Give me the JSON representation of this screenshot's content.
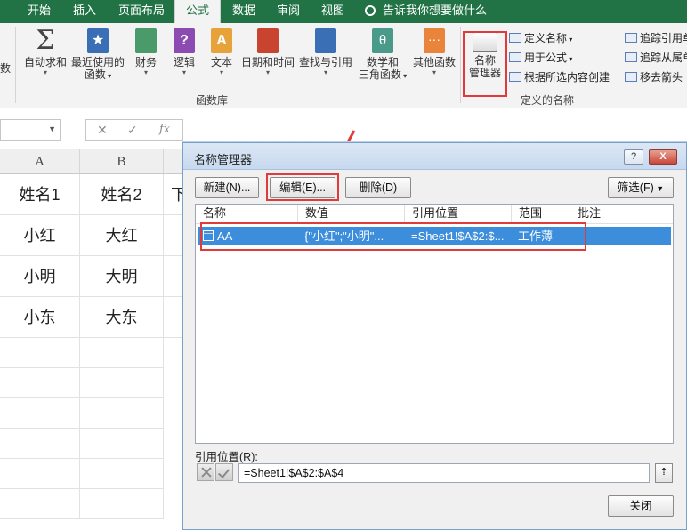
{
  "ribbon_tabs": [
    {
      "label": "开始"
    },
    {
      "label": "插入"
    },
    {
      "label": "页面布局"
    },
    {
      "label": "公式"
    },
    {
      "label": "数据"
    },
    {
      "label": "审阅"
    },
    {
      "label": "视图"
    }
  ],
  "tell_me": "告诉我你想要做什么",
  "ribbon": {
    "insert_function_partial": "数",
    "buttons": [
      {
        "label1": "自动求和",
        "label2": ""
      },
      {
        "label1": "最近使用的",
        "label2": "函数"
      },
      {
        "label1": "财务",
        "label2": ""
      },
      {
        "label1": "逻辑",
        "label2": ""
      },
      {
        "label1": "文本",
        "label2": ""
      },
      {
        "label1": "日期和时间",
        "label2": ""
      },
      {
        "label1": "查找与引用",
        "label2": ""
      },
      {
        "label1": "数学和",
        "label2": "三角函数"
      },
      {
        "label1": "其他函数",
        "label2": ""
      }
    ],
    "group_function_library": "函数库",
    "name_manager": {
      "line1": "名称",
      "line2": "管理器"
    },
    "define_name": "定义名称",
    "use_in_formula": "用于公式",
    "create_from_selection": "根据所选内容创建",
    "group_defined_names": "定义的名称",
    "trace_precedents": "追踪引用单",
    "trace_dependents": "追踪从属单",
    "remove_arrows": "移去箭头"
  },
  "formula_bar": {
    "fx": "fx"
  },
  "sheet": {
    "columns": [
      "A",
      "B"
    ],
    "rows": [
      [
        "姓名1",
        "姓名2"
      ],
      [
        "小红",
        "大红"
      ],
      [
        "小明",
        "大明"
      ],
      [
        "小东",
        "大东"
      ]
    ],
    "partial_c1": "下"
  },
  "dialog": {
    "title": "名称管理器",
    "help": "?",
    "close": "X",
    "buttons": {
      "new": "新建(N)...",
      "edit": "编辑(E)...",
      "delete": "删除(D)",
      "filter": "筛选(F)"
    },
    "columns": [
      "名称",
      "数值",
      "引用位置",
      "范围",
      "批注"
    ],
    "rows": [
      {
        "name": "AA",
        "value": "{\"小红\";\"小明\"...",
        "refers_to": "=Sheet1!$A$2:$...",
        "scope": "工作薄",
        "comment": ""
      }
    ],
    "refers_to_label": "引用位置(R):",
    "refers_to_value": "=Sheet1!$A$2:$A$4",
    "close_button": "关闭"
  },
  "colors": {
    "ribbon_green": "#217346",
    "highlight_red": "#e03a3a",
    "selection_blue": "#3c8ddb"
  }
}
